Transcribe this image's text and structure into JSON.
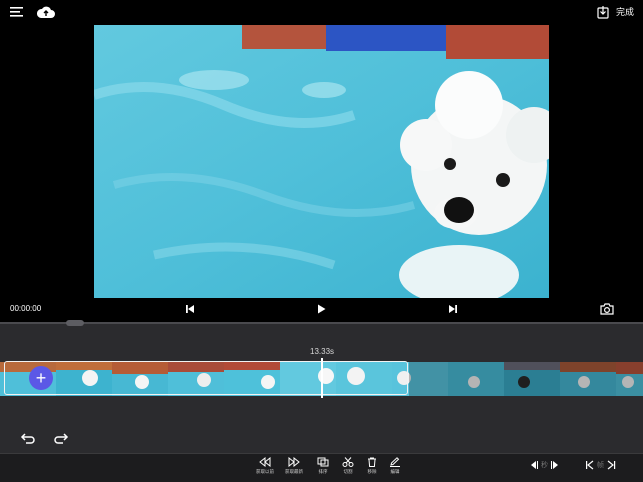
{
  "header": {
    "done_label": "完成"
  },
  "playback": {
    "timecode": "00:00:00"
  },
  "timeline": {
    "duration_label": "13.33s"
  },
  "toolbar": {
    "tools": [
      {
        "label": "获取以前"
      },
      {
        "label": "获取最新"
      },
      {
        "label": "排序"
      },
      {
        "label": "切割"
      },
      {
        "label": "移除"
      },
      {
        "label": "编辑"
      }
    ],
    "second_label": "秒",
    "frame_label": "帧"
  }
}
